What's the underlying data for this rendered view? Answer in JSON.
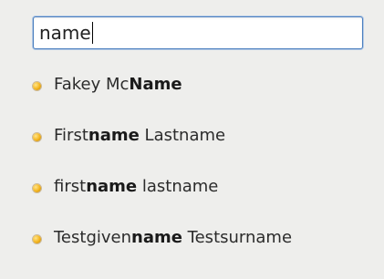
{
  "search": {
    "value": "name"
  },
  "results": [
    {
      "before": "Fakey Mc",
      "match": "Name",
      "after": ""
    },
    {
      "before": "First",
      "match": "name",
      "after": " Lastname"
    },
    {
      "before": "first",
      "match": "name",
      "after": " lastname"
    },
    {
      "before": "Testgiven",
      "match": "name",
      "after": " Testsurname"
    }
  ],
  "colors": {
    "bullet": "#f3b31c",
    "input_border": "#4b7fbf",
    "background": "#eeeeec"
  },
  "icons": {
    "result_bullet": "orange-dot-icon"
  }
}
